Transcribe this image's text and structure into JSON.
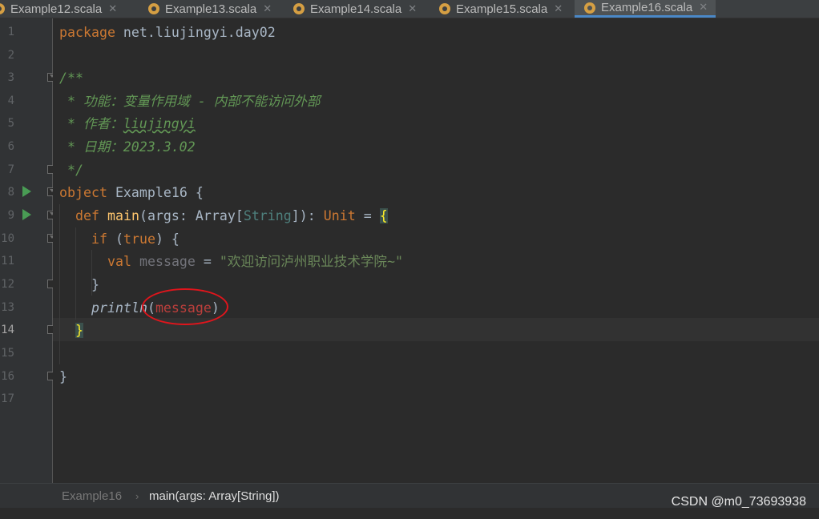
{
  "tabs": [
    {
      "label": "Example12.scala",
      "active": false
    },
    {
      "label": "Example13.scala",
      "active": false
    },
    {
      "label": "Example14.scala",
      "active": false
    },
    {
      "label": "Example15.scala",
      "active": false
    },
    {
      "label": "Example16.scala",
      "active": true
    }
  ],
  "tab_close_glyph": "✕",
  "editor": {
    "current_line": 14,
    "line_numbers": [
      "1",
      "2",
      "3",
      "4",
      "5",
      "6",
      "7",
      "8",
      "9",
      "10",
      "11",
      "12",
      "13",
      "14",
      "15",
      "16",
      "17"
    ],
    "code": {
      "l1_kw": "package",
      "l1_rest": " net.liujingyi.day02",
      "l3": "/**",
      "l4": " * 功能：变量作用域 - 内部不能访问外部",
      "l5_a": " * 作者：",
      "l5_b": "liujingyi",
      "l6": " * 日期：2023.3.02",
      "l7": " */",
      "l8_kw": "object",
      "l8_rest": " Example16 {",
      "l9_kw": "def",
      "l9_fn": "main",
      "l9_a": "(args: Array[",
      "l9_type": "String",
      "l9_b": "]): ",
      "l9_kw2": "Unit",
      "l9_c": " = ",
      "l9_brace": "{",
      "l10_kw": "if",
      "l10_a": " (",
      "l10_kw2": "true",
      "l10_b": ") {",
      "l11_kw": "val",
      "l11_var": "message",
      "l11_a": " = ",
      "l11_str": "\"欢迎访问泸州职业技术学院~\"",
      "l12": "}",
      "l13_fn": "println",
      "l13_a": "(",
      "l13_err": "message",
      "l13_b": ")",
      "l14_brace": "}",
      "l16": "}"
    }
  },
  "breadcrumb": {
    "items": [
      "Example16",
      "main(args: Array[String])"
    ],
    "separator": "›"
  },
  "watermark": "CSDN @m0_73693938",
  "colors": {
    "keyword": "#cc7832",
    "comment": "#629755",
    "string": "#6a8759",
    "error": "#bc3f3c",
    "annotation": "#e0151c"
  }
}
